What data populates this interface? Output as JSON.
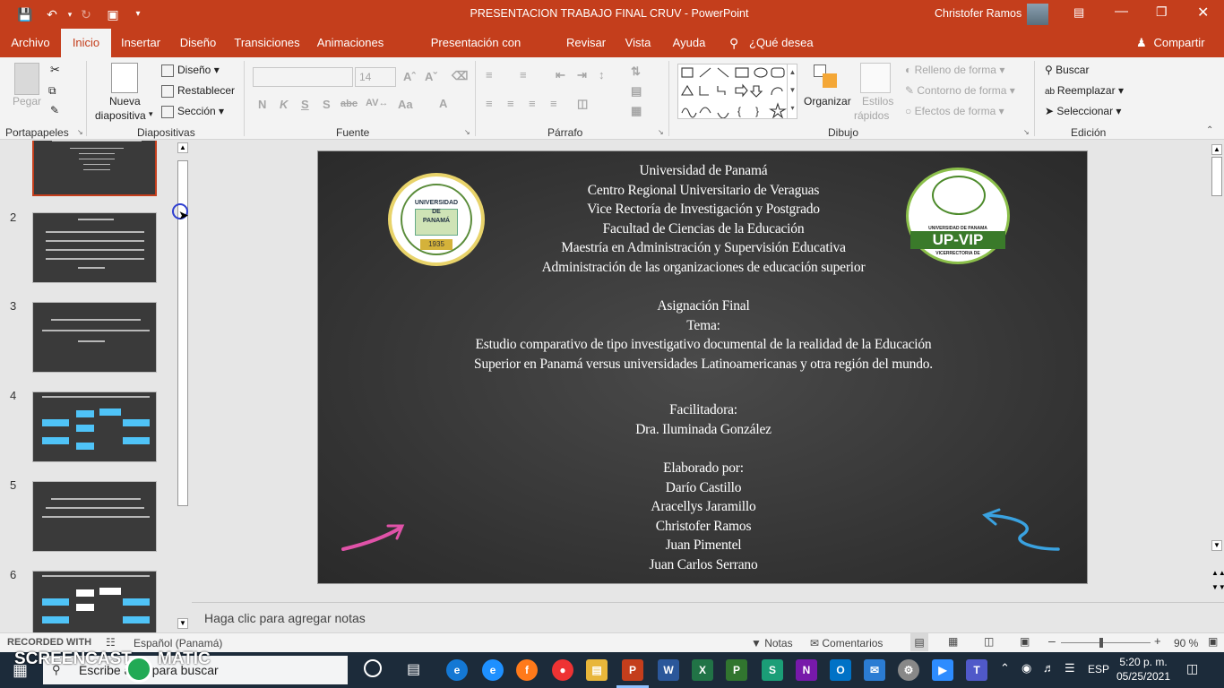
{
  "window": {
    "title": "PRESENTACION TRABAJO FINAL CRUV  -  PowerPoint",
    "user": "Christofer Ramos"
  },
  "tabs": [
    "Archivo",
    "Inicio",
    "Insertar",
    "Diseño",
    "Transiciones",
    "Animaciones",
    "Presentación con diapositivas",
    "Revisar",
    "Vista",
    "Ayuda"
  ],
  "tellme": "¿Qué desea hacer?",
  "share": "Compartir",
  "ribbon": {
    "clipboard": {
      "paste": "Pegar",
      "group": "Portapapeles"
    },
    "slides": {
      "new_slide_1": "Nueva",
      "new_slide_2": "diapositiva",
      "layout": "Diseño",
      "reset": "Restablecer",
      "section": "Sección",
      "group": "Diapositivas"
    },
    "font": {
      "size": "14",
      "group": "Fuente",
      "b": "N",
      "i": "K",
      "u": "S",
      "s": "S",
      "strike": "abc",
      "aa": "Aa",
      "color": "A"
    },
    "paragraph": {
      "group": "Párrafo"
    },
    "drawing": {
      "arrange": "Organizar",
      "styles_1": "Estilos",
      "styles_2": "rápidos",
      "fill": "Relleno de forma",
      "outline": "Contorno de forma",
      "effects": "Efectos de forma",
      "group": "Dibujo"
    },
    "editing": {
      "find": "Buscar",
      "replace": "Reemplazar",
      "select": "Seleccionar",
      "group": "Edición"
    }
  },
  "thumbnails": [
    {
      "n": ""
    },
    {
      "n": "2"
    },
    {
      "n": "3"
    },
    {
      "n": "4"
    },
    {
      "n": "5"
    },
    {
      "n": "6"
    }
  ],
  "slide": {
    "logo_left_top": "UNIVERSIDAD",
    "logo_left_mid": "DE",
    "logo_left_bot": "PANAMÁ",
    "logo_left_year": "1935",
    "logo_right_top": "UNIVERSIDAD DE PANAMA",
    "logo_right_main": "UP-VIP",
    "logo_right_bot": "VICERRECTORIA DE",
    "lines": [
      "Universidad de Panamá",
      "Centro Regional Universitario de Veraguas",
      "Vice Rectoría de Investigación y Postgrado",
      "Facultad de Ciencias de la Educación",
      "Maestría en Administración y Supervisión Educativa",
      "Administración de las organizaciones de educación superior",
      "",
      "Asignación Final",
      "Tema:",
      "Estudio comparativo de tipo investigativo documental de la realidad de la Educación",
      "Superior en Panamá versus  universidades Latinoamericanas  y otra región del mundo.",
      "",
      "",
      "Facilitadora:",
      "Dra. Iluminada González",
      "",
      "Elaborado por:",
      "Darío Castillo",
      "Aracellys Jaramillo",
      "Christofer Ramos",
      "Juan Pimentel",
      "Juan Carlos Serrano"
    ]
  },
  "notes_placeholder": "Haga clic para agregar notas",
  "status": {
    "recorded": "RECORDED WITH",
    "language": "Español (Panamá)",
    "notes": "Notas",
    "comments": "Comentarios",
    "zoom": "90 %"
  },
  "taskbar": {
    "search": "Escribe aquí para buscar",
    "time": "5:20 p. m.",
    "date": "05/25/2021",
    "lang": "ESP",
    "watermark_1": "SCREENCAST",
    "watermark_2": "MATIC"
  },
  "colors": {
    "accent": "#c43e1c"
  }
}
